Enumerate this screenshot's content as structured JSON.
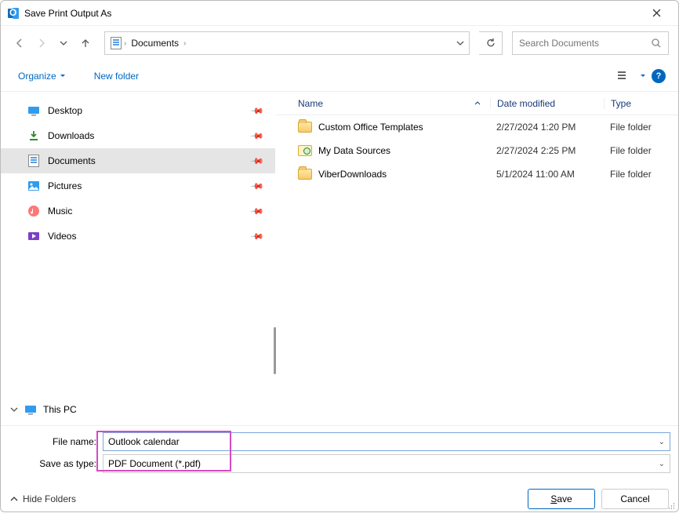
{
  "window": {
    "title": "Save Print Output As"
  },
  "nav": {
    "location": "Documents"
  },
  "search": {
    "placeholder": "Search Documents"
  },
  "toolbar": {
    "organize": "Organize",
    "new_folder": "New folder"
  },
  "columns": {
    "name": "Name",
    "date": "Date modified",
    "type": "Type"
  },
  "sidebar": {
    "items": [
      {
        "label": "Desktop"
      },
      {
        "label": "Downloads"
      },
      {
        "label": "Documents"
      },
      {
        "label": "Pictures"
      },
      {
        "label": "Music"
      },
      {
        "label": "Videos"
      }
    ],
    "this_pc": "This PC"
  },
  "files": [
    {
      "name": "Custom Office Templates",
      "date": "2/27/2024 1:20 PM",
      "type": "File folder",
      "icon": "folder"
    },
    {
      "name": "My Data Sources",
      "date": "2/27/2024 2:25 PM",
      "type": "File folder",
      "icon": "db"
    },
    {
      "name": "ViberDownloads",
      "date": "5/1/2024 11:00 AM",
      "type": "File folder",
      "icon": "folder"
    }
  ],
  "form": {
    "filename_label": "File name:",
    "filename_value": "Outlook calendar",
    "savetype_label": "Save as type:",
    "savetype_value": "PDF Document (*.pdf)"
  },
  "footer": {
    "hide_folders": "Hide Folders",
    "save": "Save",
    "cancel": "Cancel"
  }
}
